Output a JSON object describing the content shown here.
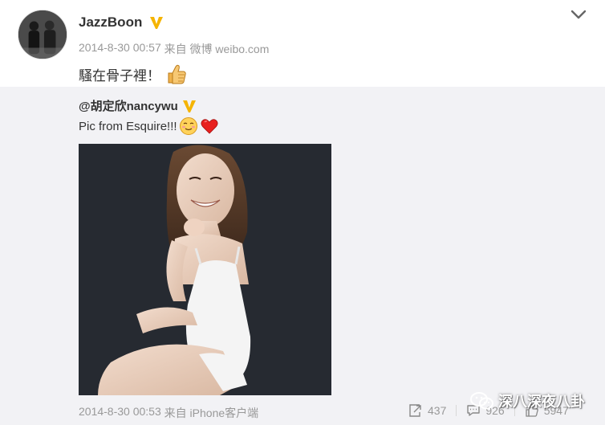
{
  "post": {
    "author": "JazzBoon",
    "timestamp": "2014-8-30 00:57",
    "via_label": " 来自 ",
    "source": "微博 weibo.com",
    "text": "騷在骨子裡！",
    "verified_badge_color": "#f5b400"
  },
  "repost": {
    "author": "@胡定欣nancywu",
    "text": "Pic from Esquire!!!",
    "timestamp": "2014-8-30 00:53",
    "via_label": " 来自 ",
    "source": "iPhone客户端",
    "background_color": "#f2f2f5"
  },
  "actions": {
    "forward_count": "437",
    "comment_count": "926",
    "like_count": "5947"
  },
  "icons": {
    "avatar": "avatar",
    "verified": "verified-v-badge",
    "expand": "chevron-down-icon",
    "thumbs_up": "thumbs-up-emoji",
    "smile": "shy-smile-emoji",
    "heart": "heart-emoji",
    "forward": "forward-icon",
    "comment": "comment-icon",
    "like": "like-icon"
  },
  "watermark": {
    "text": "深八深夜八卦"
  }
}
